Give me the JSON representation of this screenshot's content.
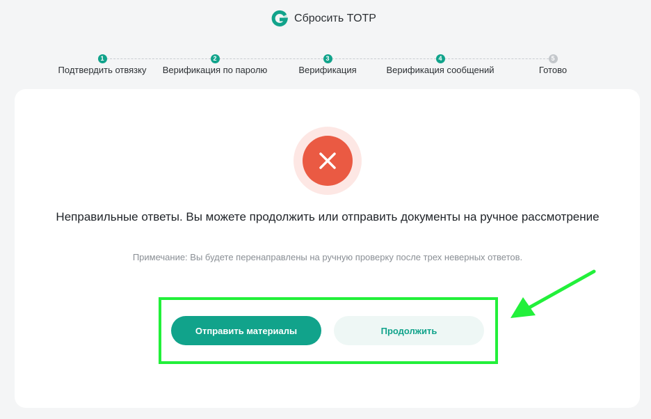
{
  "header": {
    "title": "Сбросить TOTP",
    "logo_icon": "g-logo-icon"
  },
  "steps": [
    {
      "number": "1",
      "label": "Подтвердить отвязку",
      "state": "done"
    },
    {
      "number": "2",
      "label": "Верификация по паролю",
      "state": "done"
    },
    {
      "number": "3",
      "label": "Верификация",
      "state": "done"
    },
    {
      "number": "4",
      "label": "Верификация сообщений",
      "state": "done"
    },
    {
      "number": "5",
      "label": "Готово",
      "state": "pending"
    }
  ],
  "result": {
    "status_icon": "error-x-icon",
    "message": "Неправильные ответы. Вы можете продолжить или отправить документы на ручное рассмотрение",
    "note": "Примечание: Вы будете перенаправлены на ручную проверку после трех неверных ответов."
  },
  "actions": {
    "submit_label": "Отправить материалы",
    "continue_label": "Продолжить"
  },
  "annotation": {
    "highlight_color": "#22f03a",
    "arrow_icon": "pointer-arrow-icon"
  },
  "colors": {
    "accent": "#11a38b",
    "error": "#ea5a43",
    "pending": "#c3c7cb"
  }
}
